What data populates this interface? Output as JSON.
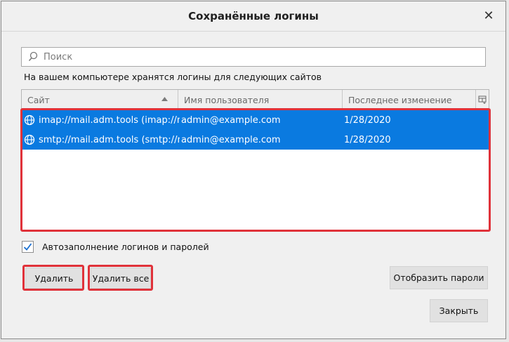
{
  "dialog": {
    "title": "Сохранённые логины",
    "close_glyph": "✕"
  },
  "search": {
    "placeholder": "Поиск"
  },
  "info_text": "На вашем компьютере хранятся логины для следующих сайтов",
  "table": {
    "columns": [
      "Сайт",
      "Имя пользователя",
      "Последнее изменение"
    ],
    "rows": [
      {
        "site": "imap://mail.adm.tools (imap://m...",
        "user": "admin@example.com",
        "date": "1/28/2020"
      },
      {
        "site": "smtp://mail.adm.tools (smtp://m...",
        "user": "admin@example.com",
        "date": "1/28/2020"
      }
    ]
  },
  "autofill": {
    "label": "Автозаполнение логинов и паролей",
    "checked": true
  },
  "buttons": {
    "remove": "Удалить",
    "remove_all": "Удалить все",
    "show_passwords": "Отобразить пароли",
    "close": "Закрыть"
  },
  "colors": {
    "selection": "#0a7ae0",
    "highlight": "#e0323a"
  }
}
